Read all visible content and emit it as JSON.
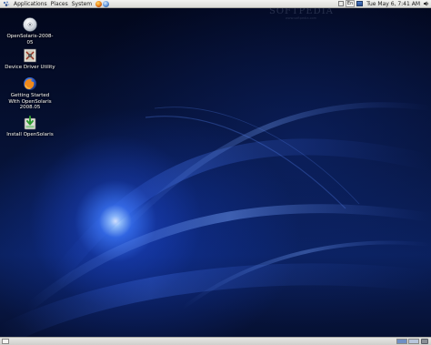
{
  "top_panel": {
    "menus": [
      "Applications",
      "Places",
      "System"
    ],
    "launchers": [
      "firefox-icon",
      "mail-icon"
    ],
    "keyboard_indicator": "En",
    "clock": "Tue May  6,  7:41 AM"
  },
  "watermark": {
    "logo": "SOFTPEDIA",
    "url": "www.softpedia.com"
  },
  "desktop_icons": [
    {
      "label": "OpenSolaris-2008-\n05",
      "icon": "cd-disc-icon"
    },
    {
      "label": "Device Driver Utility",
      "icon": "device-driver-icon"
    },
    {
      "label": "Getting Started\nWith OpenSolaris\n2008.05",
      "icon": "firefox-icon"
    },
    {
      "label": "Install OpenSolaris",
      "icon": "installer-icon"
    }
  ],
  "bottom_panel": {
    "workspaces": 2
  },
  "colors": {
    "wallpaper_base": "#061236",
    "glow": "#5a8cff",
    "panel": "#dcdcd8"
  }
}
